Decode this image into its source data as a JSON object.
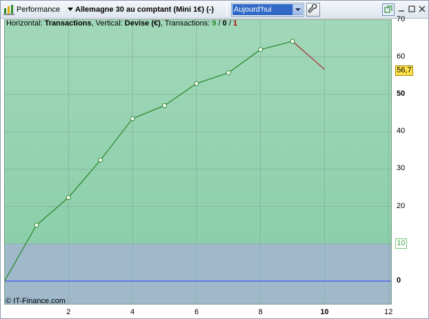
{
  "toolbar": {
    "performance_label": "Performance",
    "instrument_label": "Allemagne 30 au comptant (Mini 1€) (-)",
    "period_value": "Aujourd'hui",
    "window_buttons": [
      "restore-icon",
      "minimize-icon",
      "maximize-icon",
      "close-icon"
    ]
  },
  "info": {
    "horizontal_label": "Horizontal: ",
    "horizontal_value": "Transactions",
    "vertical_label": ", Vertical: ",
    "vertical_value": "Devise (€)",
    "transactions_label": ", Transactions: ",
    "tx_winning": "9",
    "tx_sep1": " / ",
    "tx_neutral": "0",
    "tx_sep2": " / ",
    "tx_losing": "1"
  },
  "watermark": "© IT-Finance.com",
  "badges": {
    "last_value": "56,7",
    "level_value": "10"
  },
  "colors": {
    "upper_zone": "#8ccfaa",
    "lower_zone": "#9fb9cb",
    "winning_line": "#2e8b2e",
    "losing_line": "#a83232",
    "zero_line": "#2b3bff"
  },
  "chart_data": {
    "type": "line",
    "x": [
      0,
      1,
      2,
      3,
      4,
      5,
      6,
      7,
      8,
      9,
      10
    ],
    "series": [
      {
        "values": [
          0,
          15,
          22.4,
          32.4,
          43.5,
          47,
          52.9,
          55.8,
          62,
          64.2,
          56.7
        ]
      }
    ],
    "last_segment": "losing",
    "xlim": [
      0,
      12
    ],
    "ylim": [
      -6,
      70
    ],
    "x_ticks": [
      "2",
      "4",
      "6",
      "8",
      "10",
      "12"
    ],
    "y_ticks": [
      "0",
      "10",
      "20",
      "30",
      "40",
      "50",
      "60",
      "70"
    ],
    "highlight_x_tick": "10",
    "highlight_y_ticks": [
      "0",
      "50"
    ],
    "threshold_level": 10,
    "grid": true
  }
}
